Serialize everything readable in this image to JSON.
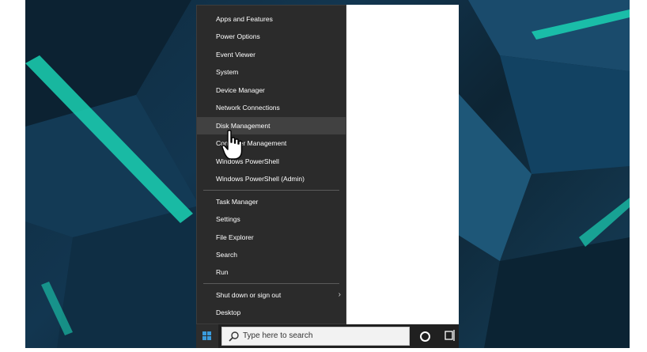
{
  "menu": {
    "items": [
      "Apps and Features",
      "Power Options",
      "Event Viewer",
      "System",
      "Device Manager",
      "Network Connections",
      "Disk Management",
      "Computer Management",
      "Windows PowerShell",
      "Windows PowerShell (Admin)",
      "Task Manager",
      "Settings",
      "File Explorer",
      "Search",
      "Run",
      "Shut down or sign out",
      "Desktop"
    ],
    "hovered_item": "Disk Management"
  },
  "taskbar": {
    "search_placeholder": "Type here to search",
    "icons": [
      "windows-logo-icon",
      "search-icon",
      "cortana-circle-icon",
      "task-view-icon"
    ]
  },
  "colors": {
    "menu_bg": "#2b2b2b",
    "menu_hover": "#414141",
    "taskbar_bg": "#202020",
    "accent_teal": "#1bd1b3"
  }
}
